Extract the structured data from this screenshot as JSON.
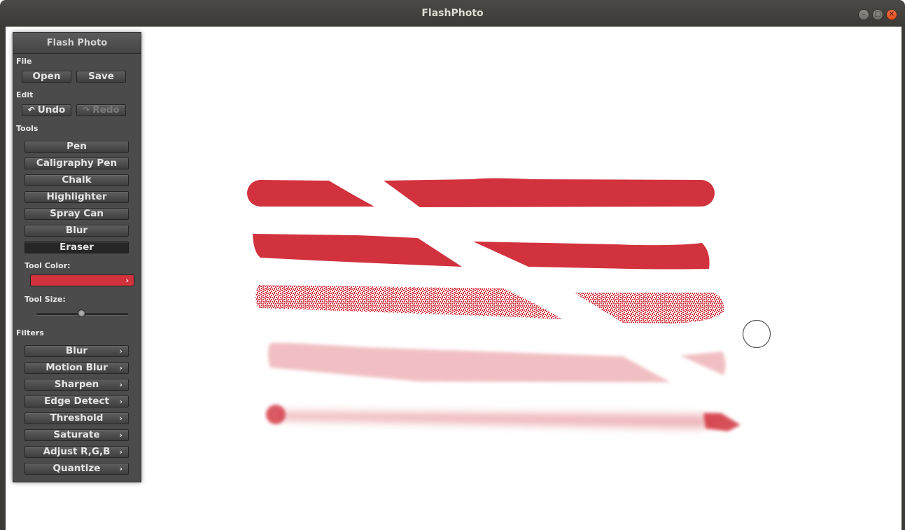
{
  "window": {
    "title": "FlashPhoto"
  },
  "panel": {
    "title": "Flash Photo",
    "file": {
      "label": "File",
      "open": "Open",
      "save": "Save"
    },
    "edit": {
      "label": "Edit",
      "undo": "Undo",
      "redo": "Redo"
    },
    "tools": {
      "label": "Tools",
      "items": [
        "Pen",
        "Caligraphy Pen",
        "Chalk",
        "Highlighter",
        "Spray Can",
        "Blur",
        "Eraser"
      ],
      "selected": "Eraser"
    },
    "tool_color": {
      "label": "Tool Color:",
      "value": "#d2323d"
    },
    "tool_size": {
      "label": "Tool Size:",
      "level": 0.5
    },
    "filters": {
      "label": "Filters",
      "items": [
        "Blur",
        "Motion Blur",
        "Sharpen",
        "Edge Detect",
        "Threshold",
        "Saturate",
        "Adjust R,G,B",
        "Quantize"
      ]
    }
  },
  "colors": {
    "stroke": "#d2323d",
    "panel": "#4b4b4b"
  }
}
